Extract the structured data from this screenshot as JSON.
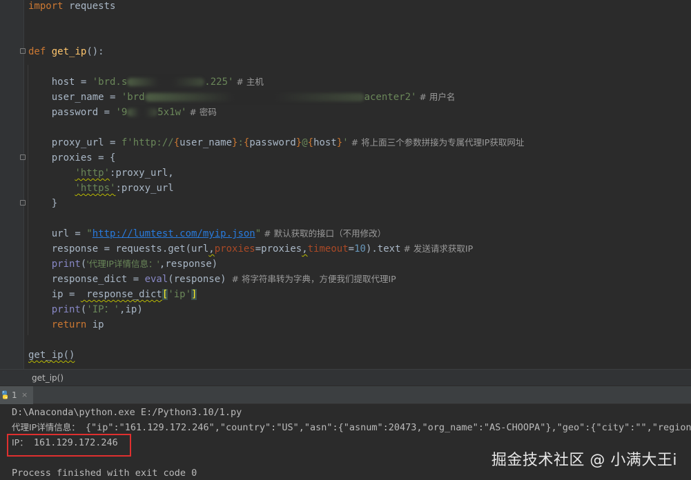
{
  "editor": {
    "lines": {
      "import_kw": "import",
      "import_mod": " requests",
      "def_kw": "def",
      "def_name": "get_ip",
      "def_tail": "():",
      "host_a": "    host = ",
      "host_s1": "'brd.s",
      "host_s2": ".225'",
      "host_cmt": " # 主机",
      "user_a": "    user_name = ",
      "user_s1": "'brd",
      "user_s2": "acenter2'",
      "user_cmt": " # 用户名",
      "pwd_a": "    password = ",
      "pwd_s1": "'9",
      "pwd_s2": "5x1w'",
      "pwd_cmt": " # 密码",
      "proxy_a": "    proxy_url = ",
      "proxy_f": "f'http://",
      "proxy_b1": "{",
      "proxy_v1": "user_name",
      "proxy_b2": "}",
      "proxy_c": ":",
      "proxy_b3": "{",
      "proxy_v2": "password",
      "proxy_b4": "}",
      "proxy_at": "@",
      "proxy_b5": "{",
      "proxy_v3": "host",
      "proxy_b6": "}",
      "proxy_end": "'",
      "proxy_cmt": " # 将上面三个参数拼接为专属代理IP获取网址",
      "proxies_a": "    proxies = {",
      "http_key": "'http'",
      "http_val": ":proxy_url,",
      "https_key": "'https'",
      "https_val": ":proxy_url",
      "close_brace": "    }",
      "url_a": "    url = ",
      "url_q1": "\"",
      "url_link": "http://lumtest.com/myip.json",
      "url_q2": "\"",
      "url_cmt": " # 默认获取的接口（不用修改）",
      "resp_a": "    response = requests.get(url",
      "resp_comma": ",",
      "resp_p1": "proxies",
      "resp_eq1": "=proxies",
      "resp_comma2": ",",
      "resp_p2": "timeout",
      "resp_eq2": "=",
      "resp_num": "10",
      "resp_tail": ").text",
      "resp_cmt": " # 发送请求获取IP",
      "print1_fn": "print",
      "print1_open": "(",
      "print1_str": "'代理IP详情信息：'",
      "print1_tail": ",response)",
      "dict_a": "    response_dict = ",
      "dict_eval": "eval",
      "dict_tail": "(response)",
      "dict_cmt": "  # 将字符串转为字典，方便我们提取代理IP",
      "ip_a": "    ip = ",
      "ip_b": " response_dict",
      "ip_lb": "[",
      "ip_key": "'ip'",
      "ip_rb": "]",
      "print2_fn": "print",
      "print2_open": "(",
      "print2_str": "'IP：'",
      "print2_tail": ",ip)",
      "return_kw": "return",
      "return_tail": " ip",
      "call": "get_ip()"
    }
  },
  "breadcrumb": {
    "label": "get_ip()"
  },
  "run_panel": {
    "tab_number": "1",
    "tab_close": "×",
    "icon": "python-icon"
  },
  "console": {
    "line1": "D:\\Anaconda\\python.exe E:/Python3.10/1.py",
    "line2_label": "代理IP详情信息：",
    "line2_json": " {\"ip\":\"161.129.172.246\",\"country\":\"US\",\"asn\":{\"asnum\":20473,\"org_name\":\"AS-CHOOPA\"},\"geo\":{\"city\":\"\",\"region\"",
    "line3_label": "IP：",
    "line3_value": " 161.129.172.246",
    "line4": "Process finished with exit code 0"
  },
  "watermark": "掘金技术社区 @ 小满大王i",
  "colors": {
    "editor_bg": "#2b2b2b",
    "keyword": "#cc7832",
    "function": "#ffc66d",
    "string": "#6a8759",
    "comment": "#808080",
    "highlight_box": "#e0302f"
  }
}
